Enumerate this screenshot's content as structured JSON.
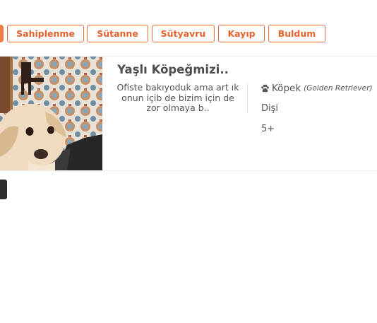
{
  "filters": {
    "items": [
      {
        "label": "Sahiplenme"
      },
      {
        "label": "Sütanne"
      },
      {
        "label": "Sütyavru"
      },
      {
        "label": "Kayıp"
      },
      {
        "label": "Buldum"
      }
    ]
  },
  "listing": {
    "title": "Yaşlı Köpeğmizi..",
    "description": "Ofiste bakıyoduk ama art ık onun içib de bizim için de zor olmaya b..",
    "species": "Köpek",
    "breed": "(Golden Retriever)",
    "gender": "Dişi",
    "age": "5+",
    "species_icon": "paw-icon"
  },
  "colors": {
    "accent": "#e86e3c",
    "text": "#555555"
  }
}
